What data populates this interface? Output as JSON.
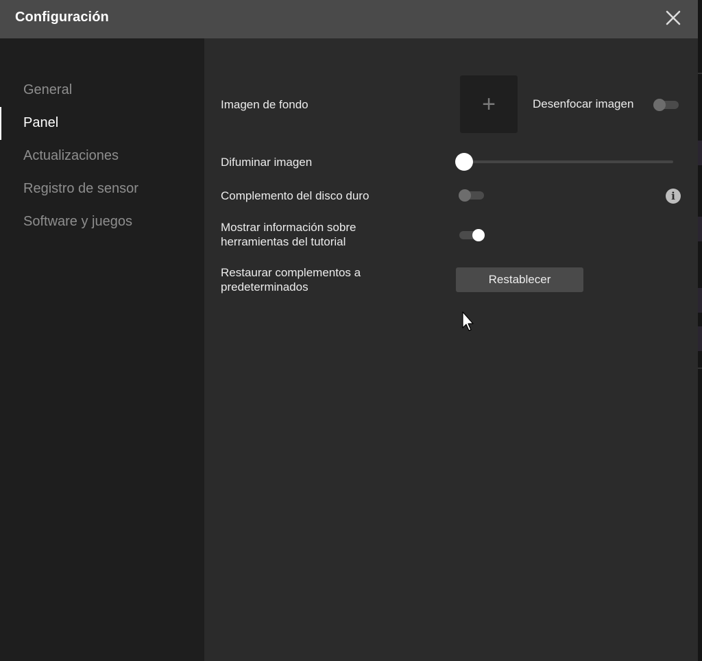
{
  "window": {
    "title": "Configuración"
  },
  "icons": {
    "close": "close-icon",
    "add": "plus-icon",
    "info": "info-icon",
    "cursor": "mouse-pointer-icon"
  },
  "sidebar": {
    "items": [
      {
        "label": "General",
        "active": false
      },
      {
        "label": "Panel",
        "active": true
      },
      {
        "label": "Actualizaciones",
        "active": false
      },
      {
        "label": "Registro de sensor",
        "active": false
      },
      {
        "label": "Software y juegos",
        "active": false
      }
    ]
  },
  "panel": {
    "background_image": {
      "label": "Imagen de fondo",
      "add_symbol": "+",
      "blur_toggle_label": "Desenfocar imagen",
      "blur_toggle_on": false
    },
    "dim_image": {
      "label": "Difuminar imagen",
      "value_percent": 0
    },
    "hdd_plugin": {
      "label": "Complemento del disco duro",
      "toggle_on": false,
      "info_symbol": "i"
    },
    "tutorial_tips": {
      "label": "Mostrar información sobre herramientas del tutorial",
      "toggle_on": true
    },
    "restore_plugins": {
      "label": "Restaurar complementos a predeterminados",
      "button_label": "Restablecer"
    }
  },
  "colors": {
    "titlebar": "#4a4a4a",
    "sidebar": "#1e1e1e",
    "main": "#2b2b2b",
    "active_text": "#ffffff",
    "inactive_text": "#8e8e8e"
  }
}
